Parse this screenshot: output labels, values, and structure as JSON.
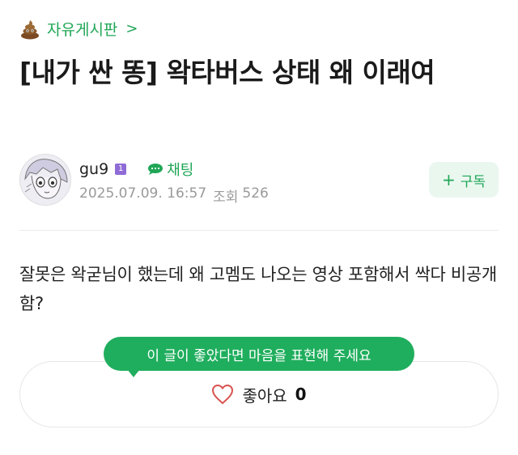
{
  "board": {
    "icon": "poop-icon",
    "name": "자유게시판",
    "chevron": ">"
  },
  "post": {
    "title": "[내가 싼 똥] 왁타버스 상태 왜 이래여",
    "body": "잘못은 왁굳님이 했는데 왜 고멤도 나오는 영상 포함해서 싹다 비공개함?"
  },
  "author": {
    "avatar": "avatar-drawing",
    "name": "gu9",
    "level_badge": "1",
    "chat_label": "채팅",
    "date": "2025.07.09. 16:57",
    "views_label": "조회",
    "views": "526"
  },
  "subscribe": {
    "plus": "+",
    "label": "구독"
  },
  "like": {
    "tooltip": "이 글이 좋았다면 마음을 표현해 주세요",
    "label": "좋아요",
    "count": "0"
  },
  "colors": {
    "accent": "#1fa656",
    "tooltip_bg": "#1fae5d",
    "badge": "#8f6bd6",
    "heart": "#d9534f"
  }
}
